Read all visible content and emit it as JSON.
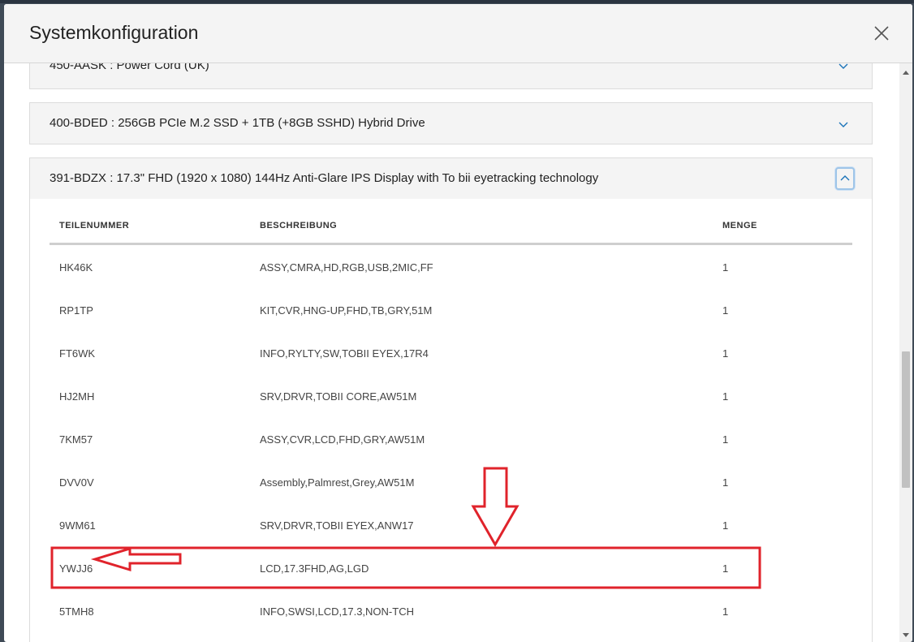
{
  "modal": {
    "title": "Systemkonfiguration",
    "close_icon": "close-icon"
  },
  "accordion": [
    {
      "title": "450-AASK : Power Cord (UK)",
      "expanded": false
    },
    {
      "title": "400-BDED : 256GB PCIe M.2 SSD + 1TB (+8GB SSHD) Hybrid Drive",
      "expanded": false
    },
    {
      "title": "391-BDZX : 17.3\" FHD (1920 x 1080) 144Hz Anti-Glare IPS Display with To bii eyetracking technology",
      "expanded": true
    }
  ],
  "table": {
    "headers": [
      "TEILENUMMER",
      "BESCHREIBUNG",
      "MENGE"
    ],
    "rows": [
      {
        "part": "HK46K",
        "desc": "ASSY,CMRA,HD,RGB,USB,2MIC,FF",
        "qty": "1"
      },
      {
        "part": "RP1TP",
        "desc": "KIT,CVR,HNG-UP,FHD,TB,GRY,51M",
        "qty": "1"
      },
      {
        "part": "FT6WK",
        "desc": "INFO,RYLTY,SW,TOBII EYEX,17R4",
        "qty": "1"
      },
      {
        "part": "HJ2MH",
        "desc": "SRV,DRVR,TOBII CORE,AW51M",
        "qty": "1"
      },
      {
        "part": "7KM57",
        "desc": "ASSY,CVR,LCD,FHD,GRY,AW51M",
        "qty": "1"
      },
      {
        "part": "DVV0V",
        "desc": "Assembly,Palmrest,Grey,AW51M",
        "qty": "1"
      },
      {
        "part": "9WM61",
        "desc": "SRV,DRVR,TOBII EYEX,ANW17",
        "qty": "1"
      },
      {
        "part": "YWJJ6",
        "desc": "LCD,17.3FHD,AG,LGD",
        "qty": "1"
      },
      {
        "part": "5TMH8",
        "desc": "INFO,SWSI,LCD,17.3,NON-TCH",
        "qty": "1"
      }
    ]
  },
  "colors": {
    "annotation_red": "#e0232b",
    "chevron_blue": "#1a73b8"
  }
}
